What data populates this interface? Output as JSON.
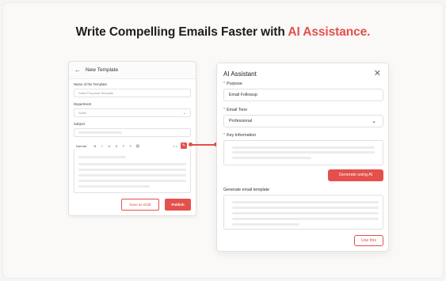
{
  "headline": {
    "prefix": "Write Compelling Emails Faster with ",
    "accent": "AI Assistance."
  },
  "template_form": {
    "back_icon": "arrow-left-icon",
    "title": "New Template",
    "name_label": "Name of the Template",
    "name_placeholder": "Sales Proposal Template",
    "department_label": "Department",
    "department_value": "Sales",
    "subject_label": "Subject",
    "toolbar": {
      "style_value": "Normal",
      "buttons": [
        "B",
        "I",
        "U",
        "S",
        "≡",
        "≡",
        "⛓"
      ],
      "code_label": "< >",
      "ai_icon": "magic-pen-icon"
    },
    "save_draft_label": "Save as Draft",
    "publish_label": "Publish"
  },
  "ai_assistant": {
    "title": "AI Assistant",
    "close_icon": "close-icon",
    "purpose_label": "Purpose",
    "purpose_value": "Email Followup",
    "tone_label": "Email Tone",
    "tone_value": "Professional",
    "key_info_label": "Key Information",
    "generate_button": "Generate using AI",
    "output_label": "Generate email template",
    "use_button": "Use this",
    "required_marker": "*"
  },
  "colors": {
    "accent": "#e4504b"
  }
}
